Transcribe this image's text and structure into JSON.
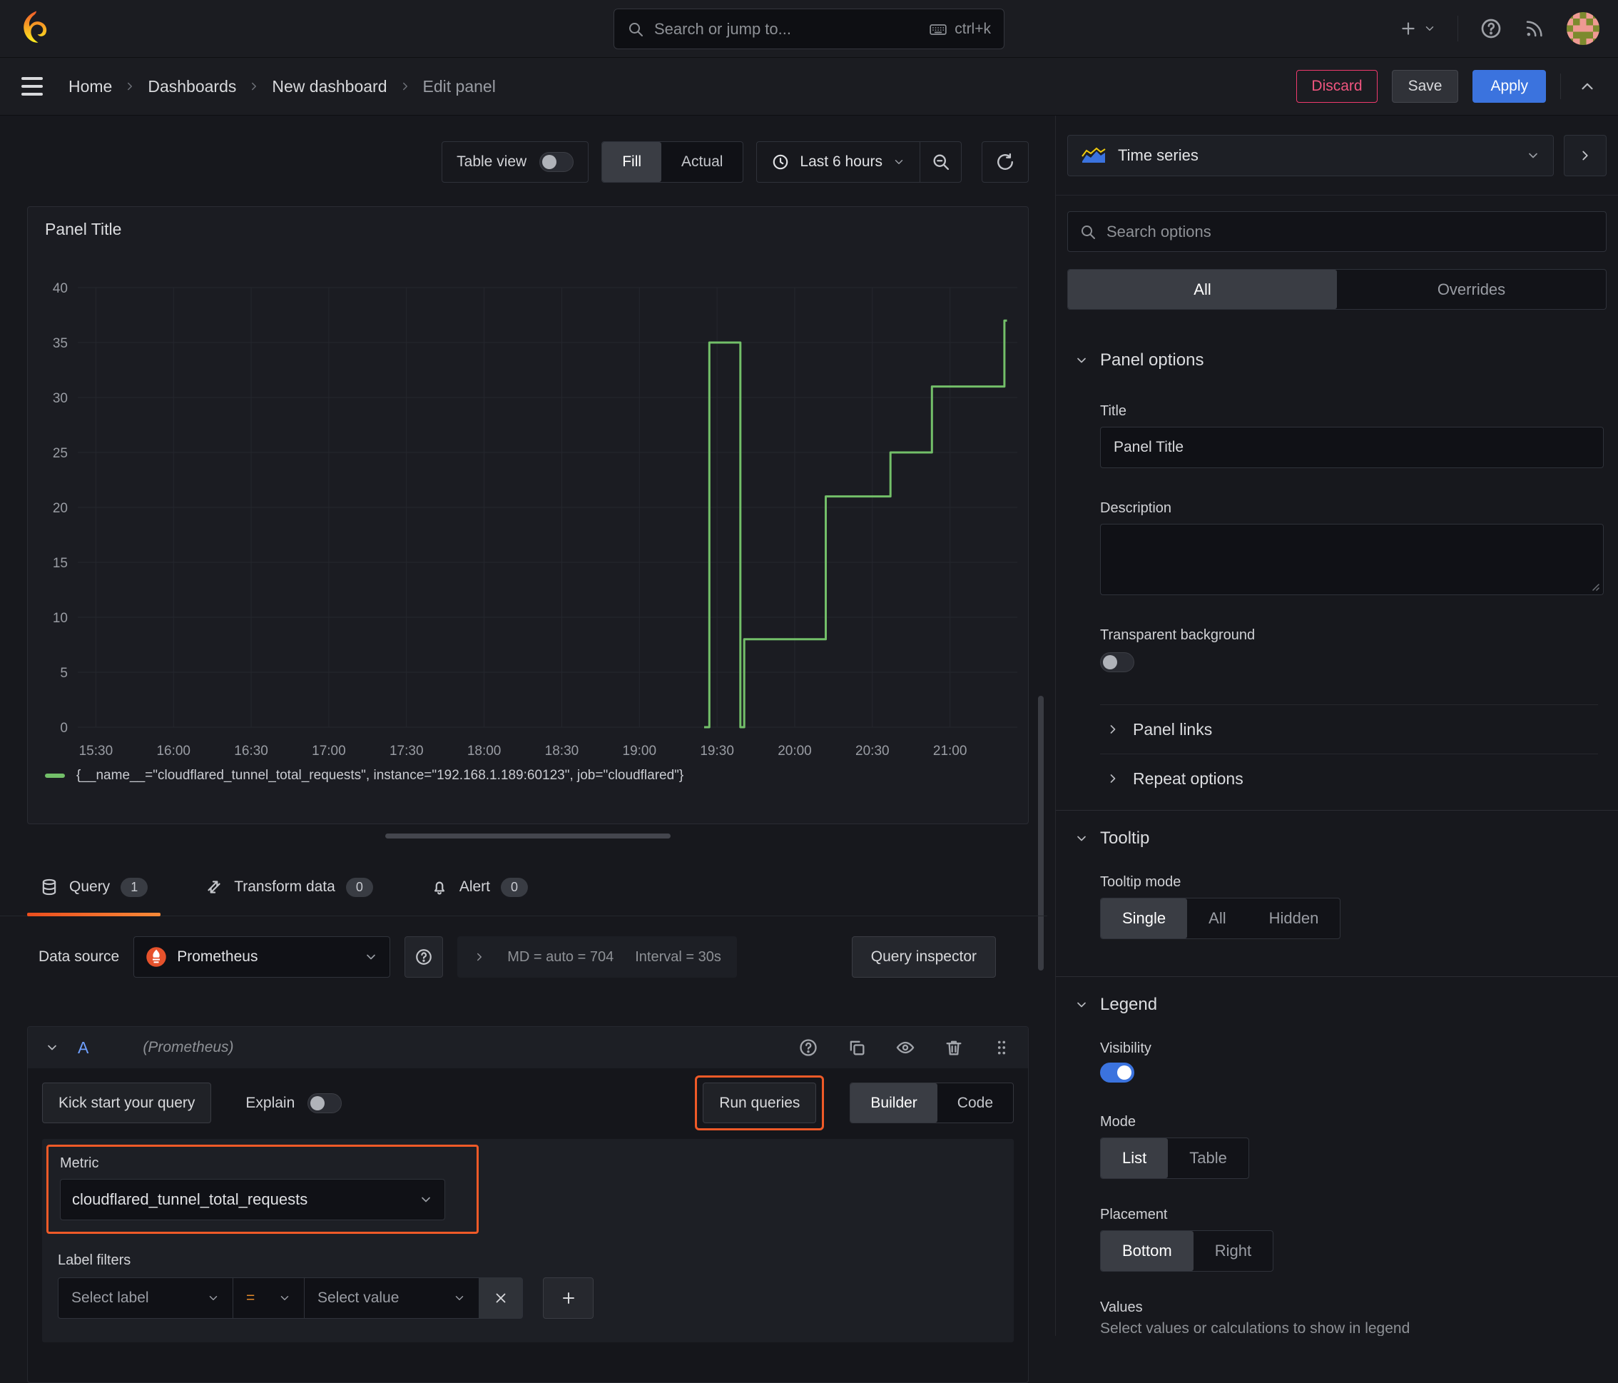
{
  "header": {
    "search": {
      "placeholder": "Search or jump to...",
      "shortcut": "ctrl+k"
    }
  },
  "nav": {
    "breadcrumb": [
      "Home",
      "Dashboards",
      "New dashboard",
      "Edit panel"
    ],
    "discard_label": "Discard",
    "save_label": "Save",
    "apply_label": "Apply"
  },
  "toolbar": {
    "table_view_label": "Table view",
    "fill_label": "Fill",
    "actual_label": "Actual",
    "time_range_label": "Last 6 hours"
  },
  "panel": {
    "title": "Panel Title"
  },
  "chart_data": {
    "type": "line",
    "step": true,
    "title": "Panel Title",
    "x_ticks": [
      "15:30",
      "16:00",
      "16:30",
      "17:00",
      "17:30",
      "18:00",
      "18:30",
      "19:00",
      "19:30",
      "20:00",
      "20:30",
      "21:00"
    ],
    "x_minutes_per_tick": 30,
    "x_range_minutes": [
      -7,
      356
    ],
    "y_ticks": [
      0,
      5,
      10,
      15,
      20,
      25,
      30,
      35,
      40
    ],
    "ylim": [
      0,
      40
    ],
    "grid": true,
    "legend_position": "bottom",
    "series": [
      {
        "name": "{__name__=\"cloudflared_tunnel_total_requests\", instance=\"192.168.1.189:60123\", job=\"cloudflared\"}",
        "color": "#73bf69",
        "points_unit": "minutes_after_15:30",
        "points": [
          [
            235,
            0
          ],
          [
            237,
            0
          ],
          [
            237,
            35
          ],
          [
            249,
            35
          ],
          [
            249,
            0
          ],
          [
            250.5,
            0
          ],
          [
            250.5,
            8
          ],
          [
            282,
            8
          ],
          [
            282,
            21
          ],
          [
            307,
            21
          ],
          [
            307,
            25
          ],
          [
            323,
            25
          ],
          [
            323,
            31
          ],
          [
            351,
            31
          ],
          [
            351,
            37
          ],
          [
            352,
            37
          ]
        ],
        "samples_readable": [
          [
            "19:27",
            35
          ],
          [
            "19:39",
            0
          ],
          [
            "19:40",
            8
          ],
          [
            "20:12",
            21
          ],
          [
            "20:37",
            25
          ],
          [
            "20:53",
            31
          ],
          [
            "21:21",
            37
          ]
        ]
      }
    ]
  },
  "query_tabs": {
    "query": {
      "label": "Query",
      "count": "1"
    },
    "transform": {
      "label": "Transform data",
      "count": "0"
    },
    "alert": {
      "label": "Alert",
      "count": "0"
    }
  },
  "datasource_bar": {
    "label": "Data source",
    "value": "Prometheus",
    "md_stat": "MD = auto = 704",
    "interval_stat": "Interval = 30s",
    "query_inspector_label": "Query inspector"
  },
  "query_editor": {
    "ref_id": "A",
    "datasource_hint": "(Prometheus)",
    "kick_start_label": "Kick start your query",
    "explain_label": "Explain",
    "run_queries_label": "Run queries",
    "builder_label": "Builder",
    "code_label": "Code",
    "metric": {
      "label": "Metric",
      "value": "cloudflared_tunnel_total_requests"
    },
    "label_filters": {
      "label": "Label filters",
      "select_label_placeholder": "Select label",
      "operator": "=",
      "select_value_placeholder": "Select value"
    }
  },
  "options_pane": {
    "visualization": "Time series",
    "search_placeholder": "Search options",
    "tabs": {
      "all": "All",
      "overrides": "Overrides"
    },
    "panel_options": {
      "heading": "Panel options",
      "title_label": "Title",
      "title_value": "Panel Title",
      "description_label": "Description",
      "transparent_label": "Transparent background"
    },
    "panel_links": {
      "heading": "Panel links"
    },
    "repeat_options": {
      "heading": "Repeat options"
    },
    "tooltip": {
      "heading": "Tooltip",
      "mode_label": "Tooltip mode",
      "modes": [
        "Single",
        "All",
        "Hidden"
      ],
      "selected_mode": "Single"
    },
    "legend": {
      "heading": "Legend",
      "visibility_label": "Visibility",
      "mode_label": "Mode",
      "modes": [
        "List",
        "Table"
      ],
      "selected_mode": "List",
      "placement_label": "Placement",
      "placements": [
        "Bottom",
        "Right"
      ],
      "selected_placement": "Bottom",
      "values_label": "Values",
      "values_hint": "Select values or calculations to show in legend"
    }
  },
  "colors": {
    "accent_blue": "#3b73de",
    "highlight_orange": "#ef5a28",
    "discard_red": "#ef3a6d",
    "series_green": "#73bf69"
  }
}
